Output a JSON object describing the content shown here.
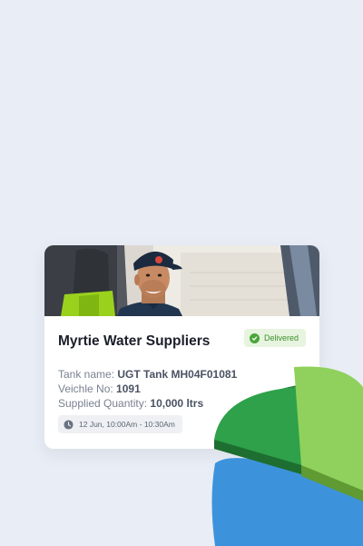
{
  "card": {
    "title": "Myrtie Water Suppliers",
    "status": {
      "label": "Delivered",
      "color": "#4aa53a",
      "icon": "check-circle-icon"
    },
    "details": [
      {
        "key": "Tank name:",
        "value": "UGT Tank MH04F01081"
      },
      {
        "key": "Veichle No:",
        "value": "1091"
      },
      {
        "key": "Supplied Quantity:",
        "value": "10,000 ltrs"
      }
    ],
    "time": {
      "label": "12 Jun, 10:00Am - 10:30Am",
      "icon": "clock-icon"
    }
  },
  "decor": {
    "pie_colors": [
      "#2ea14a",
      "#8fd15c",
      "#3c93dc"
    ]
  }
}
